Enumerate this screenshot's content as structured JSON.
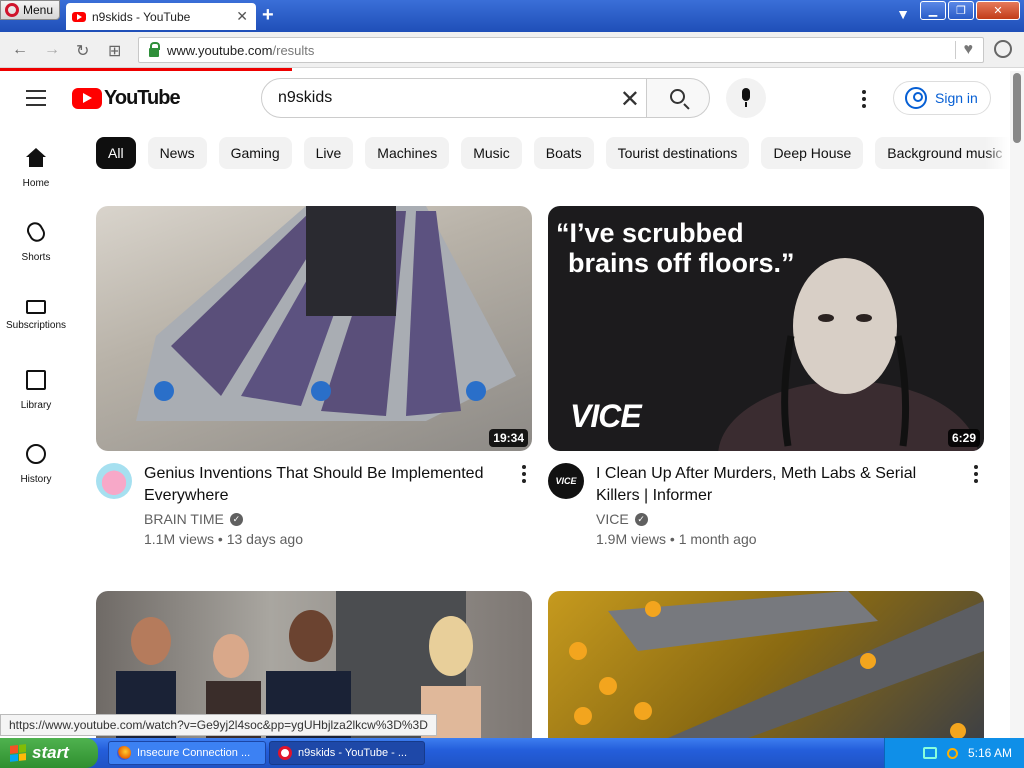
{
  "browser": {
    "menu_label": "Menu",
    "tab_title": "n9skids - YouTube",
    "url_host": "www.youtube.com",
    "url_path": "/results",
    "status_link": "https://www.youtube.com/watch?v=Ge9yj2l4soc&pp=ygUHbjlza2lkcw%3D%3D"
  },
  "youtube": {
    "logo_text": "YouTube",
    "search_query": "n9skids",
    "signin_label": "Sign in",
    "chips": [
      "All",
      "News",
      "Gaming",
      "Live",
      "Machines",
      "Music",
      "Boats",
      "Tourist destinations",
      "Deep House",
      "Background music"
    ],
    "nav": [
      {
        "label": "Home",
        "icon": "home-icon"
      },
      {
        "label": "Shorts",
        "icon": "shorts-icon"
      },
      {
        "label": "Subscriptions",
        "icon": "subscriptions-icon"
      },
      {
        "label": "Library",
        "icon": "library-icon"
      },
      {
        "label": "History",
        "icon": "history-icon"
      }
    ],
    "videos": [
      {
        "title": "Genius Inventions That Should Be Implemented Everywhere",
        "channel": "BRAIN TIME",
        "meta": "1.1M views • 13 days ago",
        "duration": "19:34"
      },
      {
        "title": "I Clean Up After Murders, Meth Labs & Serial Killers | Informer",
        "channel": "VICE",
        "meta": "1.9M views • 1 month ago",
        "duration": "6:29",
        "thumb_caption_1": "“I’ve scrubbed",
        "thumb_caption_2": "brains off floors.”",
        "thumb_logo": "VICE"
      }
    ]
  },
  "taskbar": {
    "start_label": "start",
    "tasks": [
      "Insecure Connection ...",
      "n9skids - YouTube - ..."
    ],
    "clock": "5:16 AM"
  },
  "colors": {
    "accent": "#065fd4",
    "youtube_red": "#ff0000",
    "chip_active": "#0f0f0f"
  }
}
